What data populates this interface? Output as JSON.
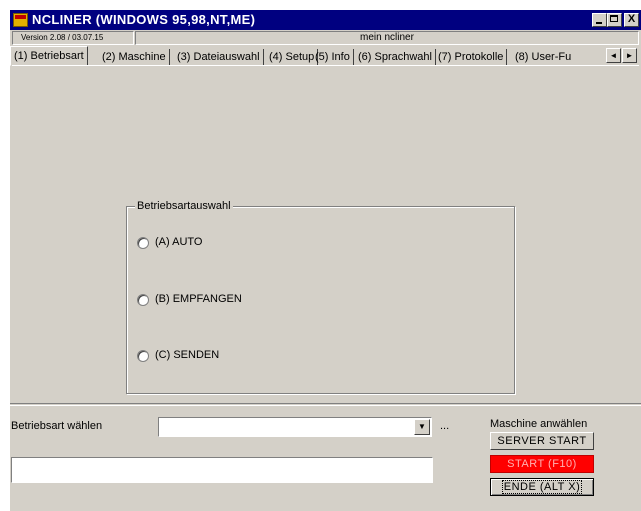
{
  "window": {
    "title": "NCLINER (WINDOWS 95,98,NT,ME)",
    "controls": {
      "minimize_icon": "minimize-icon",
      "maximize_icon": "maximize-icon",
      "close_label": "X"
    }
  },
  "status": {
    "version": "Version 2.08 / 03.07.15",
    "name": "mein ncliner"
  },
  "tabs": [
    {
      "label": "(1) Betriebsart",
      "active": true
    },
    {
      "label": "(2) Maschine"
    },
    {
      "label": "(3) Dateiauswahl"
    },
    {
      "label": "(4) Setup"
    },
    {
      "label": "(5) Info"
    },
    {
      "label": "(6) Sprachwahl"
    },
    {
      "label": "(7) Protokolle"
    },
    {
      "label": "(8) User-Fu"
    }
  ],
  "tab_scroll": {
    "left": "◄",
    "right": "►"
  },
  "group": {
    "title": "Betriebsartauswahl",
    "options": [
      {
        "label": "(A) AUTO"
      },
      {
        "label": "(B) EMPFANGEN"
      },
      {
        "label": "(C) SENDEN"
      }
    ]
  },
  "bottom": {
    "mode_label": "Betriebsart wählen",
    "combo_value": "",
    "combo_arrow": "▼",
    "ellipsis": "...",
    "machine_label": "Maschine anwählen",
    "server_button": "SERVER START",
    "start_button": "START (F10)",
    "ende_button": "ENDE (ALT X)",
    "message": ""
  },
  "colors": {
    "titlebar": "#000080",
    "start_button": "#ff0000",
    "face": "#d4d0c8"
  }
}
